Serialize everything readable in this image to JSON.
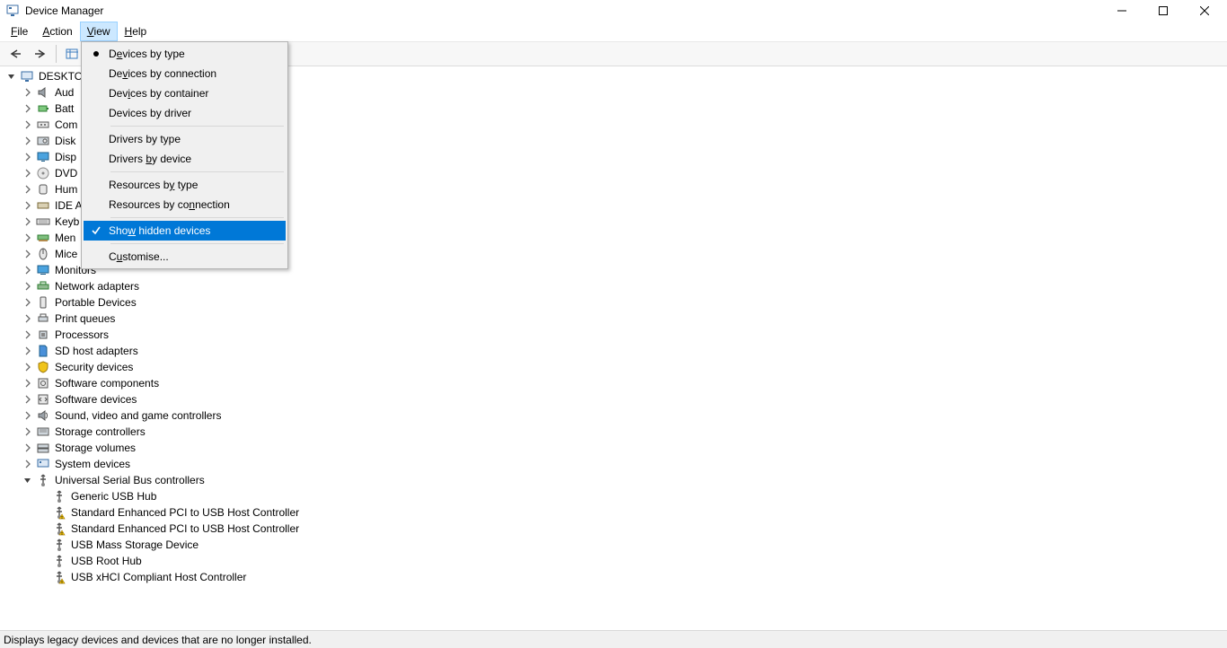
{
  "title": "Device Manager",
  "menubar": {
    "file": "File",
    "file_u": "F",
    "action": "Action",
    "action_u": "A",
    "view": "View",
    "view_u": "V",
    "help": "Help",
    "help_u": "H"
  },
  "view_menu": {
    "items": [
      {
        "label": "Devices by type",
        "mark": "bullet",
        "u": "e"
      },
      {
        "label": "Devices by connection",
        "mark": "",
        "u": "v"
      },
      {
        "label": "Devices by container",
        "mark": "",
        "u": "i"
      },
      {
        "label": "Devices by driver",
        "mark": "",
        "u": ""
      },
      {
        "sep": true
      },
      {
        "label": "Drivers by type",
        "mark": "",
        "u": ""
      },
      {
        "label": "Drivers by device",
        "mark": "",
        "u": "b"
      },
      {
        "sep": true
      },
      {
        "label": "Resources by type",
        "mark": "",
        "u": "y"
      },
      {
        "label": "Resources by connection",
        "mark": "",
        "u": "n"
      },
      {
        "sep": true
      },
      {
        "label": "Show hidden devices",
        "mark": "check",
        "selected": true,
        "u": "w"
      },
      {
        "sep": true
      },
      {
        "label": "Customise...",
        "mark": "",
        "u": "u"
      }
    ]
  },
  "tree": {
    "root": "DESKTO",
    "usb_label": "Universal Serial Bus controllers",
    "categories": [
      "Aud",
      "Batt",
      "Com",
      "Disk",
      "Disp",
      "DVD",
      "Hum",
      "IDE A",
      "Keyb",
      "Men",
      "Mice",
      "Monitors",
      "Network adapters",
      "Portable Devices",
      "Print queues",
      "Processors",
      "SD host adapters",
      "Security devices",
      "Software components",
      "Software devices",
      "Sound, video and game controllers",
      "Storage controllers",
      "Storage volumes",
      "System devices"
    ],
    "usb_children": [
      {
        "label": "Generic USB Hub",
        "warn": false
      },
      {
        "label": "Standard Enhanced PCI to USB Host Controller",
        "warn": true
      },
      {
        "label": "Standard Enhanced PCI to USB Host Controller",
        "warn": true
      },
      {
        "label": "USB Mass Storage Device",
        "warn": false
      },
      {
        "label": "USB Root Hub",
        "warn": false
      },
      {
        "label": "USB xHCI Compliant Host Controller",
        "warn": true
      }
    ]
  },
  "status": "Displays legacy devices and devices that are no longer installed.",
  "icons": {
    "cat": [
      "computer",
      "audio",
      "battery",
      "port",
      "disk",
      "display",
      "dvd",
      "hid",
      "ide",
      "keyboard",
      "memory",
      "mouse",
      "monitor",
      "network",
      "portable",
      "printer",
      "processor",
      "sd",
      "security",
      "swcomp",
      "swdev",
      "sound",
      "storage",
      "volume",
      "system",
      "usb"
    ]
  }
}
